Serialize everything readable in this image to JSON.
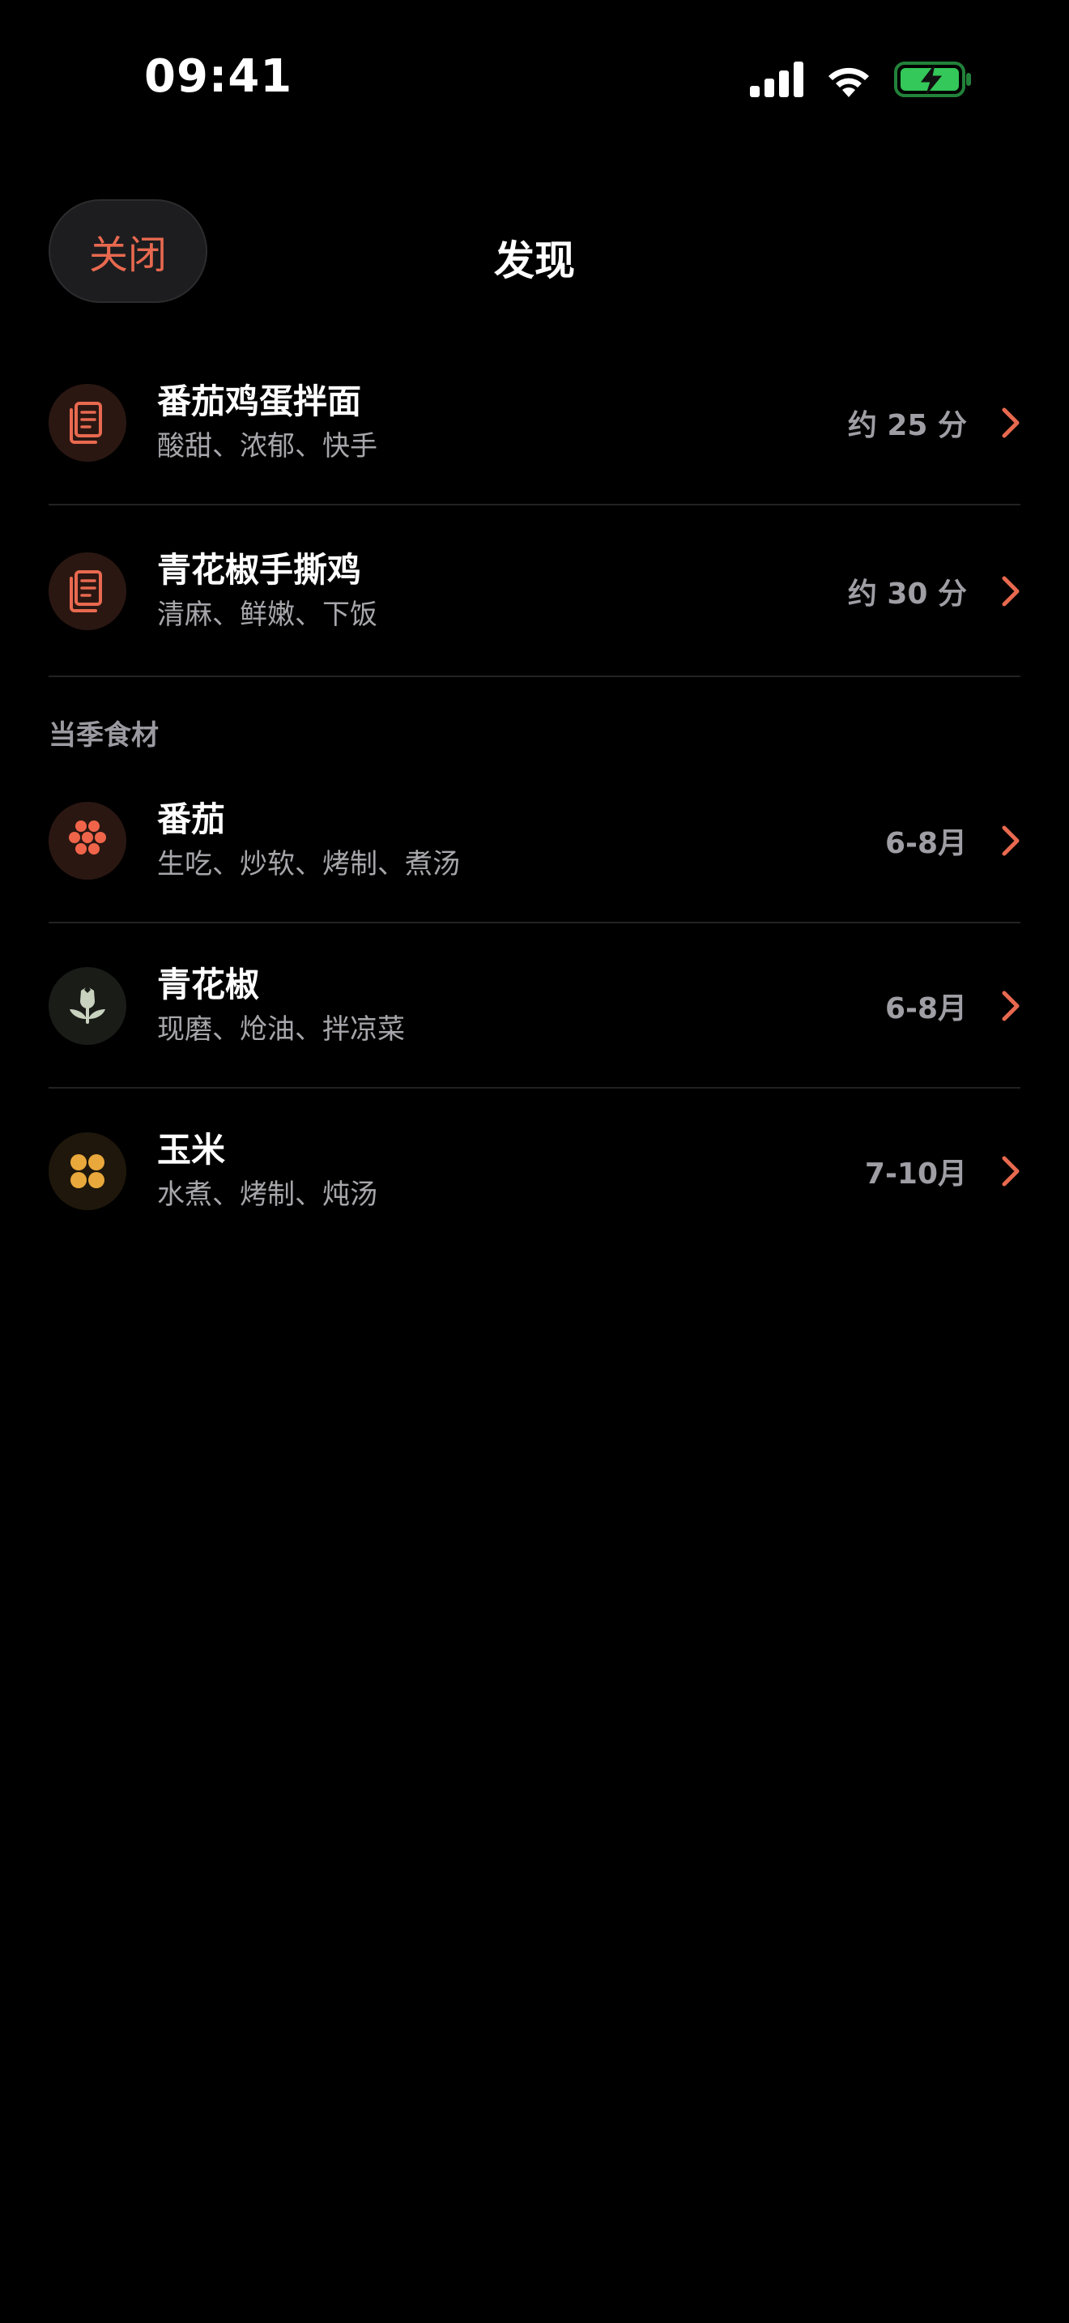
{
  "status_bar": {
    "time": "09:41"
  },
  "nav": {
    "close_label": "关闭",
    "title": "发现"
  },
  "recipes": [
    {
      "title": "番茄鸡蛋拌面",
      "subtitle": "酸甜、浓郁、快手",
      "meta": "约 25 分",
      "icon": "recipe-document-icon"
    },
    {
      "title": "青花椒手撕鸡",
      "subtitle": "清麻、鲜嫩、下饭",
      "meta": "约 30 分",
      "icon": "recipe-document-icon"
    }
  ],
  "section": {
    "title": "当季食材"
  },
  "ingredients": [
    {
      "title": "番茄",
      "subtitle": "生吃、炒软、烤制、煮汤",
      "meta": "6-8月",
      "icon": "tomato-cluster-icon"
    },
    {
      "title": "青花椒",
      "subtitle": "现磨、炝油、拌凉菜",
      "meta": "6-8月",
      "icon": "sprout-icon"
    },
    {
      "title": "玉米",
      "subtitle": "水煮、烤制、炖汤",
      "meta": "7-10月",
      "icon": "corn-kernels-icon"
    }
  ],
  "colors": {
    "accent": "#e8694f",
    "background": "#000000",
    "secondary_text": "#a6a6ab",
    "divider": "#222224",
    "battery": "#34c759",
    "corn": "#e9a83c",
    "sprout": "#c9d2bf"
  }
}
